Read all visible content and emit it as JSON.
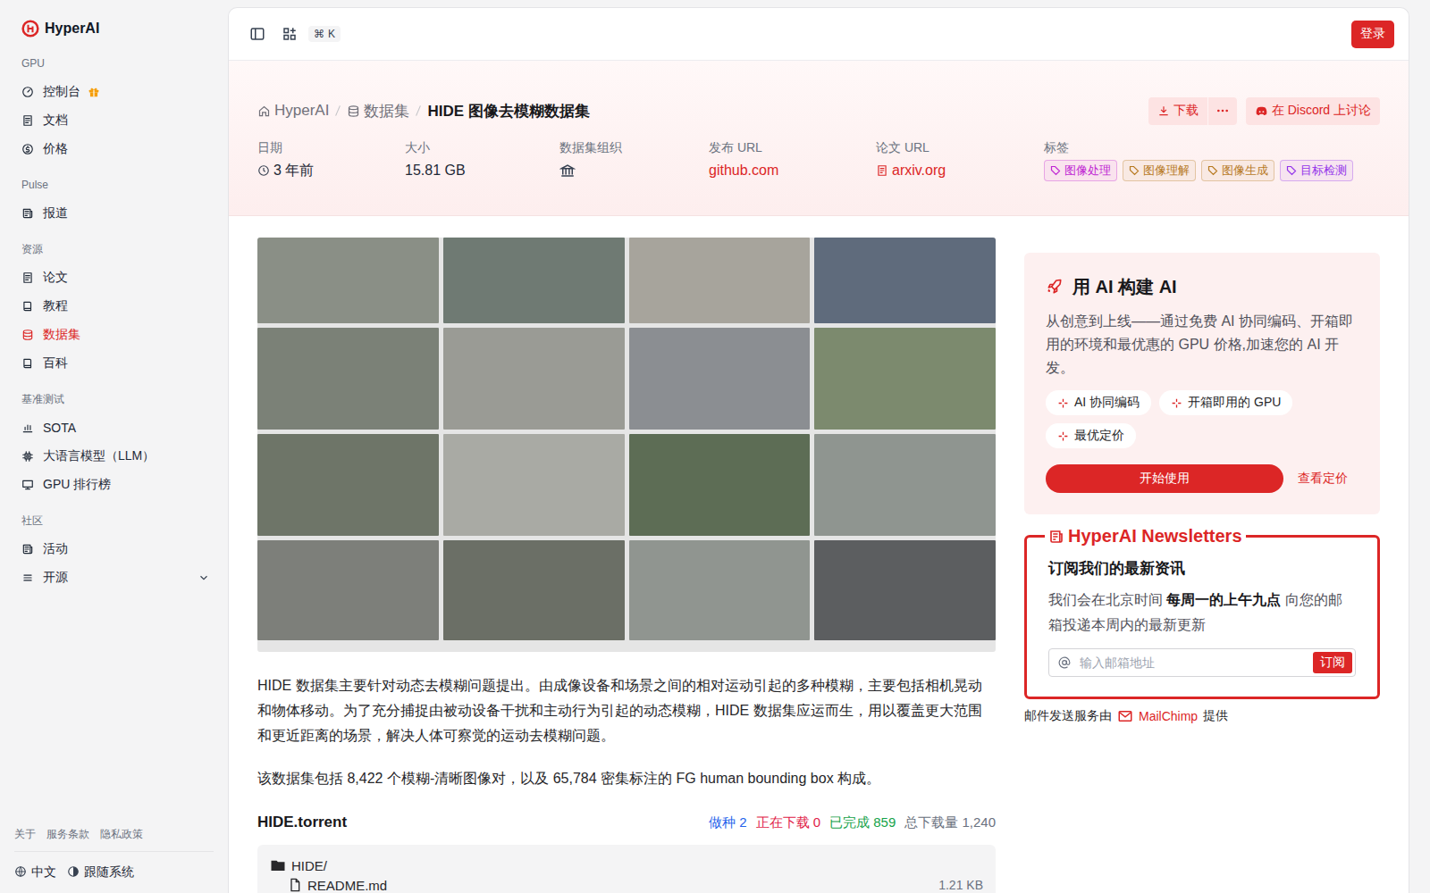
{
  "brand": {
    "name": "HyperAI"
  },
  "sidebar": {
    "sections": [
      {
        "title": "GPU",
        "items": [
          {
            "label": "控制台",
            "selected": false,
            "kind": "gift"
          },
          {
            "label": "文档",
            "selected": false,
            "kind": "plain"
          },
          {
            "label": "价格",
            "selected": false,
            "kind": "plain"
          }
        ]
      },
      {
        "title": "Pulse",
        "items": [
          {
            "label": "报道",
            "selected": false,
            "kind": "plain"
          }
        ]
      },
      {
        "title": "资源",
        "items": [
          {
            "label": "论文",
            "selected": false,
            "kind": "plain"
          },
          {
            "label": "教程",
            "selected": false,
            "kind": "plain"
          },
          {
            "label": "数据集",
            "selected": true,
            "kind": "plain"
          },
          {
            "label": "百科",
            "selected": false,
            "kind": "plain"
          }
        ]
      },
      {
        "title": "基准测试",
        "items": [
          {
            "label": "SOTA",
            "selected": false,
            "kind": "plain"
          },
          {
            "label": "大语言模型（LLM）",
            "selected": false,
            "kind": "plain"
          },
          {
            "label": "GPU 排行榜",
            "selected": false,
            "kind": "plain"
          }
        ]
      },
      {
        "title": "社区",
        "items": [
          {
            "label": "活动",
            "selected": false,
            "kind": "plain"
          },
          {
            "label": "开源",
            "selected": false,
            "kind": "expandable",
            "expanded": false
          }
        ]
      }
    ],
    "footer_links": [
      "关于",
      "服务条款",
      "隐私政策"
    ],
    "language": "中文",
    "theme": "跟随系统"
  },
  "topbar": {
    "shortcut": [
      "⌘",
      "K"
    ],
    "login": "登录"
  },
  "header": {
    "breadcrumb": [
      {
        "label": "HyperAI",
        "current": false
      },
      {
        "label": "数据集",
        "current": false
      },
      {
        "label": "HIDE 图像去模糊数据集",
        "current": true
      }
    ],
    "download": "下载",
    "discord": "在 Discord 上讨论",
    "meta": [
      {
        "label": "日期",
        "value": "3 年前",
        "kind": "time"
      },
      {
        "label": "大小",
        "value": "15.81 GB",
        "kind": "plain"
      },
      {
        "label": "数据集组织",
        "kind": "org"
      },
      {
        "label": "发布 URL",
        "value": "github.com",
        "kind": "link"
      },
      {
        "label": "论文 URL",
        "value": "arxiv.org",
        "kind": "paper-link"
      }
    ],
    "tags_label": "标签",
    "tags": [
      {
        "text": "图像处理",
        "color": "#c026d3"
      },
      {
        "text": "图像理解",
        "color": "#b7791f"
      },
      {
        "text": "图像生成",
        "color": "#b7791f"
      },
      {
        "text": "目标检测",
        "color": "#9333ea"
      }
    ]
  },
  "description": [
    "HIDE 数据集主要针对动态去模糊问题提出。由成像设备和场景之间的相对运动引起的多种模糊，主要包括相机晃动和物体移动。为了充分捕捉由被动设备干扰和主动行为引起的动态模糊，HIDE 数据集应运而生，用以覆盖更大范围和更近距离的场景，解决人体可察觉的运动去模糊问题。",
    "该数据集包括 8,422 个模糊-清晰图像对，以及 65,784 密集标注的 FG human bounding box 构成。"
  ],
  "torrent": {
    "name": "HIDE.torrent",
    "stats": [
      {
        "label": "做种",
        "value": "2",
        "color": "#2563eb"
      },
      {
        "label": "正在下载",
        "value": "0",
        "color": "#e11d48"
      },
      {
        "label": "已完成",
        "value": "859",
        "color": "#16a34a"
      },
      {
        "label": "总下载量",
        "value": "1,240",
        "color": "#6b7280"
      }
    ],
    "files": [
      {
        "name": "HIDE/",
        "kind": "folder",
        "depth": 0
      },
      {
        "name": "README.md",
        "kind": "file",
        "depth": 1,
        "size": "1.21 KB"
      }
    ]
  },
  "promo": {
    "title": "用 AI 构建 AI",
    "text": "从创意到上线——通过免费 AI 协同编码、开箱即用的环境和最优惠的 GPU 价格,加速您的 AI 开发。",
    "chips": [
      "AI 协同编码",
      "开箱即用的 GPU",
      "最优定价"
    ],
    "primary": "开始使用",
    "link": "查看定价"
  },
  "newsletter": {
    "title": "HyperAI Newsletters",
    "heading": "订阅我们的最新资讯",
    "text": [
      {
        "t": "我们会在北京时间 ",
        "bold": false
      },
      {
        "t": "每周一的上午九点",
        "bold": true
      },
      {
        "t": " 向您的邮箱投递本周内的最新更新",
        "bold": false
      }
    ],
    "placeholder": "输入邮箱地址",
    "button": "订阅",
    "footer": [
      "邮件发送服务由",
      "MailChimp",
      "提供"
    ]
  }
}
